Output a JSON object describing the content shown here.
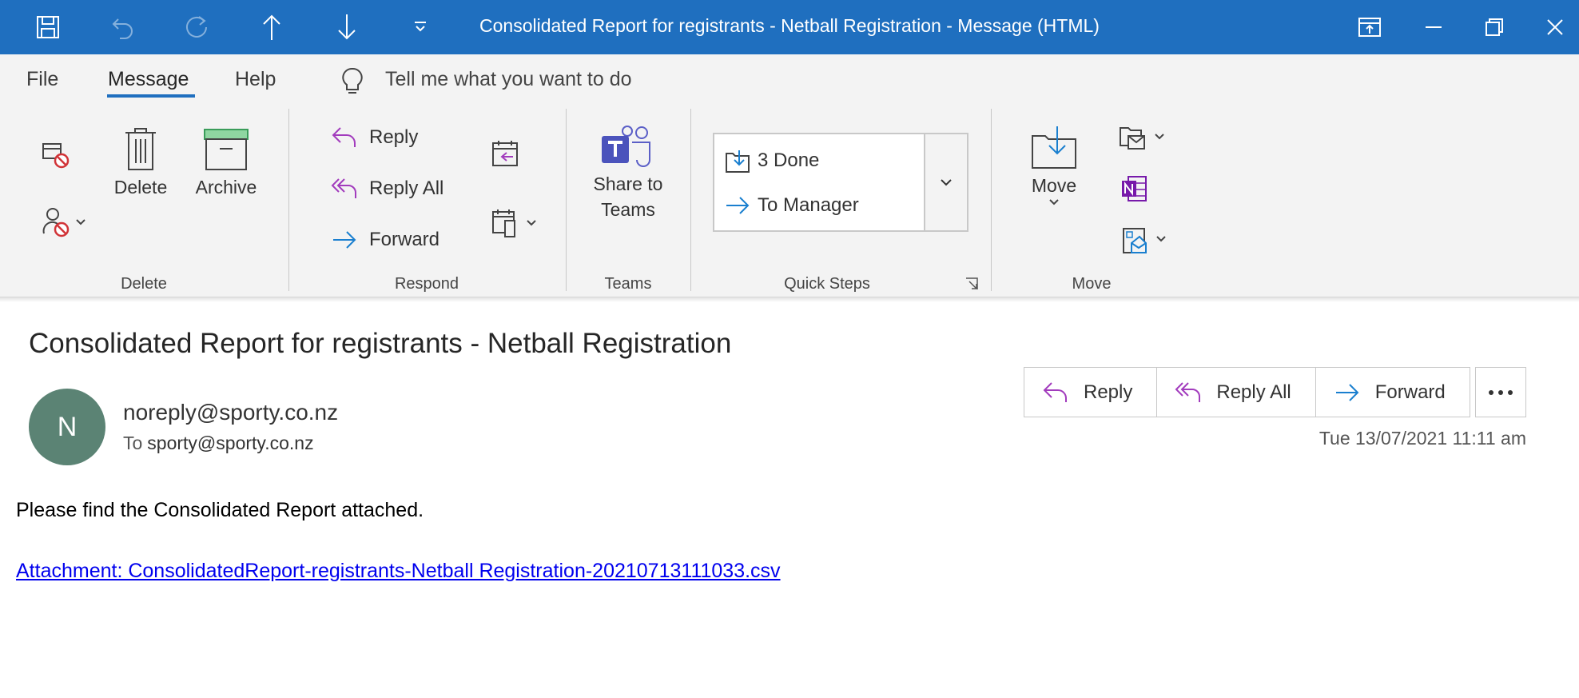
{
  "window": {
    "title": "Consolidated Report for registrants - Netball Registration  -  Message (HTML)",
    "accent_color": "#1f6fbf",
    "quick_access_icons": [
      "save-icon",
      "undo-icon",
      "redo-icon",
      "up-arrow-icon",
      "down-arrow-icon",
      "customize-icon"
    ],
    "window_controls": [
      "ribbon-display-icon",
      "minimize-icon",
      "restore-icon",
      "close-icon"
    ]
  },
  "menu": {
    "tabs": [
      "File",
      "Message",
      "Help"
    ],
    "active_tab": "Message",
    "tell_me": "Tell me what you want to do"
  },
  "ribbon": {
    "groups": {
      "delete": {
        "label": "Delete",
        "delete_button": "Delete",
        "archive_button": "Archive"
      },
      "respond": {
        "label": "Respond",
        "reply": "Reply",
        "reply_all": "Reply All",
        "forward": "Forward"
      },
      "teams": {
        "label": "Teams",
        "share_line1": "Share to",
        "share_line2": "Teams"
      },
      "quick_steps": {
        "label": "Quick Steps",
        "items": [
          "3 Done",
          "To Manager"
        ]
      },
      "move": {
        "label": "Move",
        "move_button": "Move"
      }
    }
  },
  "message": {
    "subject": "Consolidated Report for registrants - Netball Registration",
    "avatar_initial": "N",
    "avatar_color": "#5b8374",
    "sender": "noreply@sporty.co.nz",
    "to_label": "To",
    "recipient": "sporty@sporty.co.nz",
    "actions": {
      "reply": "Reply",
      "reply_all": "Reply All",
      "forward": "Forward"
    },
    "datetime": "Tue 13/07/2021 11:11 am",
    "body": "Please find the Consolidated Report attached.",
    "attachment_link": "Attachment: ConsolidatedReport-registrants-Netball Registration-20210713111033.csv"
  }
}
